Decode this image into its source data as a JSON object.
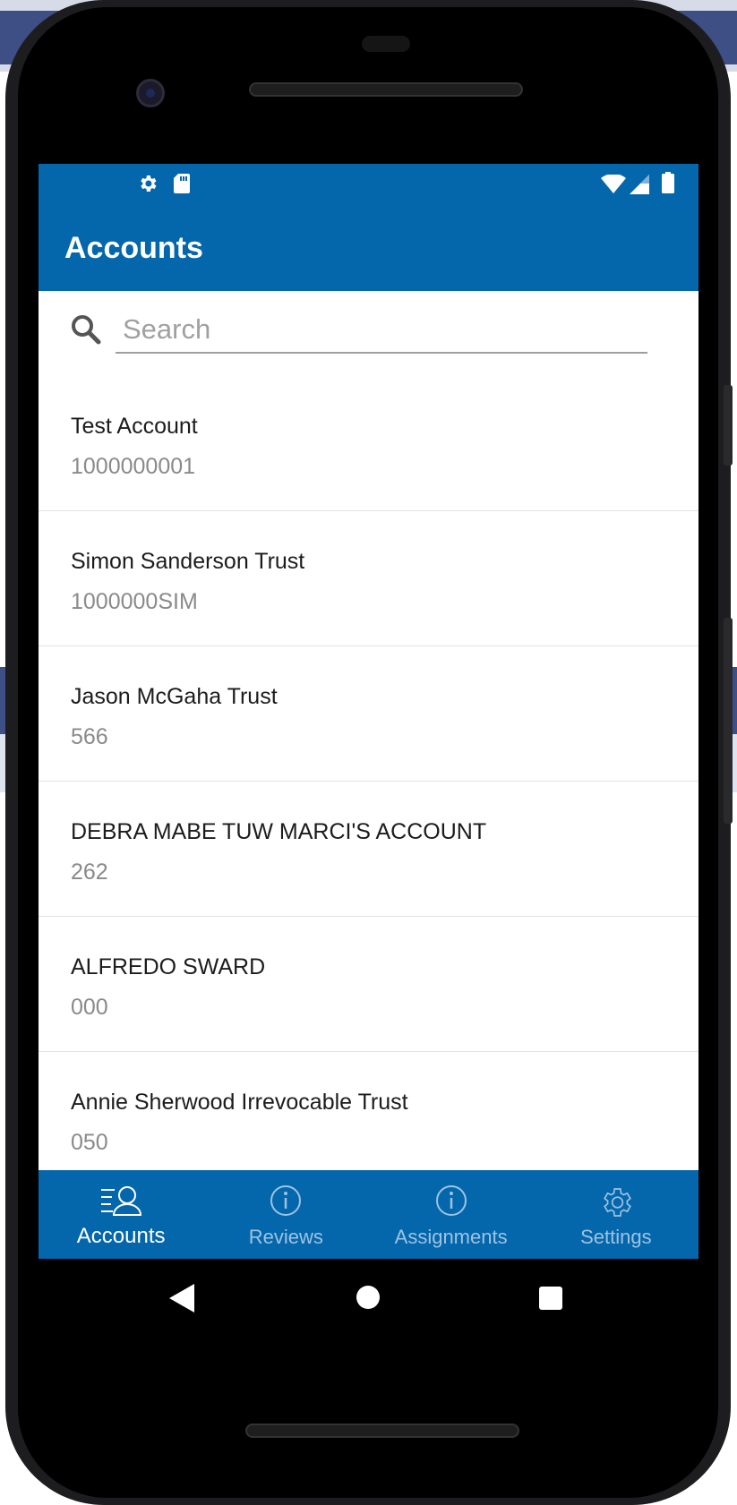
{
  "status_bar": {
    "left_icons": [
      "gear-icon",
      "sd-card-icon"
    ],
    "right_icons": [
      "wifi-icon",
      "cell-signal-icon",
      "battery-icon"
    ]
  },
  "app_bar": {
    "title": "Accounts"
  },
  "search": {
    "placeholder": "Search",
    "value": ""
  },
  "accounts": [
    {
      "name": "Test Account",
      "number": "1000000001"
    },
    {
      "name": "Simon Sanderson Trust",
      "number": "1000000SIM"
    },
    {
      "name": "Jason McGaha Trust",
      "number": "566"
    },
    {
      "name": "DEBRA MABE TUW MARCI'S ACCOUNT",
      "number": "262"
    },
    {
      "name": "ALFREDO SWARD",
      "number": "000"
    },
    {
      "name": "Annie Sherwood Irrevocable Trust",
      "number": "050"
    }
  ],
  "tabs": [
    {
      "label": "Accounts",
      "icon": "accounts-icon",
      "active": true
    },
    {
      "label": "Reviews",
      "icon": "info-icon",
      "active": false
    },
    {
      "label": "Assignments",
      "icon": "info-icon",
      "active": false
    },
    {
      "label": "Settings",
      "icon": "gear-icon",
      "active": false
    }
  ],
  "nav_bar": {
    "buttons": [
      "back-icon",
      "home-icon",
      "recents-icon"
    ]
  },
  "colors": {
    "primary": "#0467ab",
    "tab_inactive": "#9ec3e2",
    "secondary_text": "#8a8a8a"
  }
}
